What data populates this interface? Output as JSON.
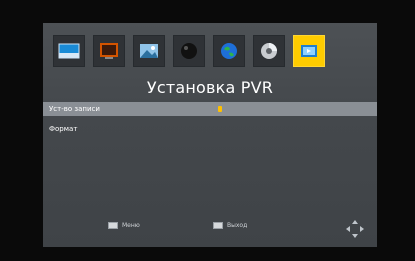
{
  "screen": {
    "title": "Установка PVR",
    "icons": [
      {
        "name": "picture-icon",
        "active": false
      },
      {
        "name": "tv-icon",
        "active": false
      },
      {
        "name": "image-icon",
        "active": false
      },
      {
        "name": "channel-icon",
        "active": false
      },
      {
        "name": "globe-icon",
        "active": false
      },
      {
        "name": "disc-icon",
        "active": false
      },
      {
        "name": "pvr-icon",
        "active": true
      }
    ],
    "menu": [
      {
        "label": "Уст-во записи",
        "selected": true
      },
      {
        "label": "Формат",
        "selected": false
      }
    ],
    "footer": {
      "menu_hint": "Меню",
      "exit_hint": "Выход"
    }
  },
  "colors": {
    "accent": "#ffcc00",
    "selected_row": "#8a8f95",
    "panel": "#44484c"
  }
}
